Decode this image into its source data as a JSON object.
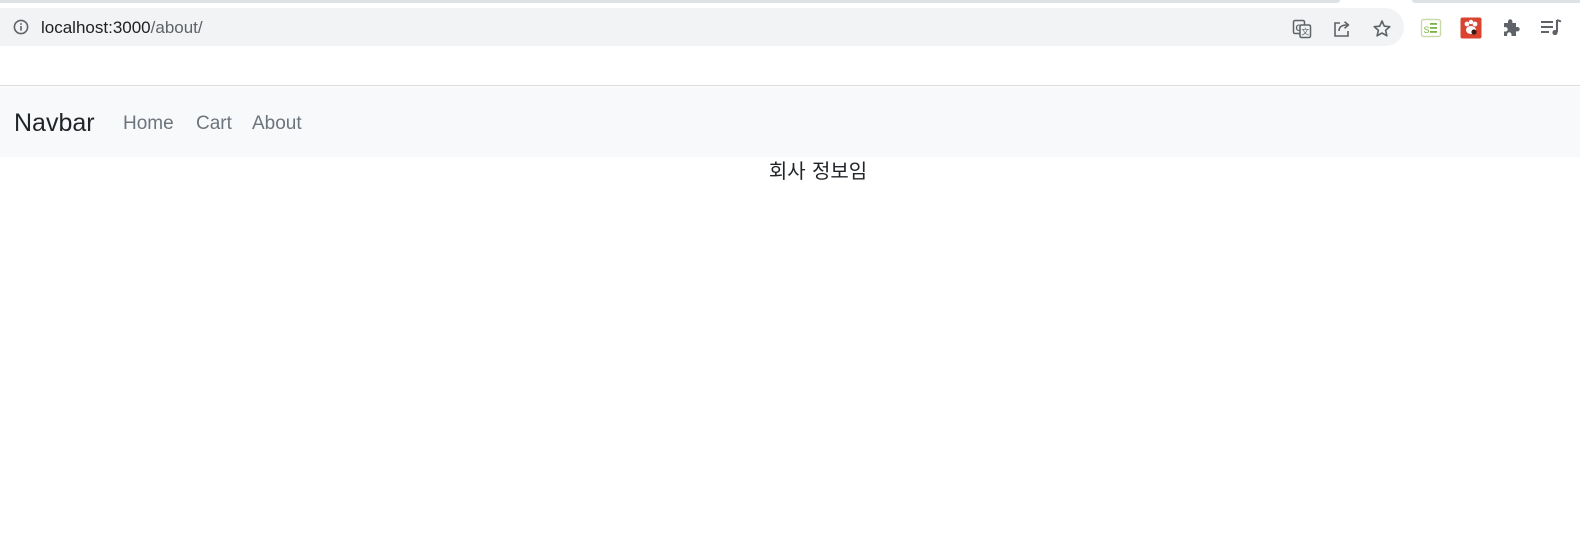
{
  "browser": {
    "url_host": "localhost:3000",
    "url_path": "/about/",
    "icons": {
      "site_info": "info-icon",
      "translate": "translate-icon",
      "share": "share-icon",
      "bookmark": "star-icon",
      "extension_1": "extension-list-icon",
      "extension_2": "extension-paw-icon",
      "extensions_menu": "puzzle-icon",
      "reading_list": "reading-list-icon"
    }
  },
  "navbar": {
    "brand": "Navbar",
    "links": [
      "Home",
      "Cart",
      "About"
    ]
  },
  "main": {
    "text": "회사 정보임"
  },
  "colors": {
    "navbar_bg": "#f8f9fa",
    "omnibox_bg": "#f1f3f4",
    "link": "#6c757d",
    "brand": "#212529"
  }
}
